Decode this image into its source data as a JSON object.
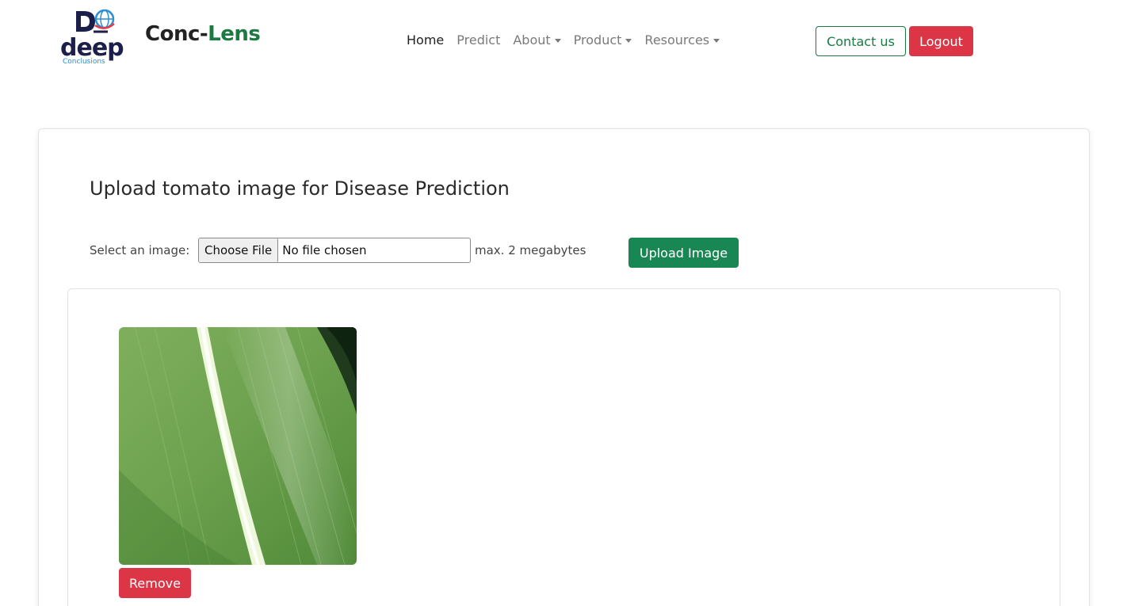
{
  "brand": {
    "logo_text": "deep",
    "logo_subtext": "Conclusions",
    "name_part1": "Conc-",
    "name_part2": "Lens",
    "accent_color": "#1a7a42"
  },
  "nav": {
    "items": [
      {
        "label": "Home",
        "active": true,
        "dropdown": false
      },
      {
        "label": "Predict",
        "active": false,
        "dropdown": false
      },
      {
        "label": "About",
        "active": false,
        "dropdown": true
      },
      {
        "label": "Product",
        "active": false,
        "dropdown": true
      },
      {
        "label": "Resources",
        "active": false,
        "dropdown": true
      }
    ],
    "contact_label": "Contact us",
    "logout_label": "Logout"
  },
  "main": {
    "heading": "Upload tomato image for Disease Prediction",
    "select_label": "Select an image:",
    "choose_file_label": "Choose File",
    "file_status": "No file chosen",
    "max_size_note": "max. 2 megabytes",
    "upload_button_label": "Upload Image"
  },
  "preview": {
    "image_alt": "uploaded leaf image",
    "remove_label": "Remove"
  },
  "colors": {
    "primary_green": "#198754",
    "danger_red": "#dc3545",
    "nav_text": "#7a7a7a"
  }
}
